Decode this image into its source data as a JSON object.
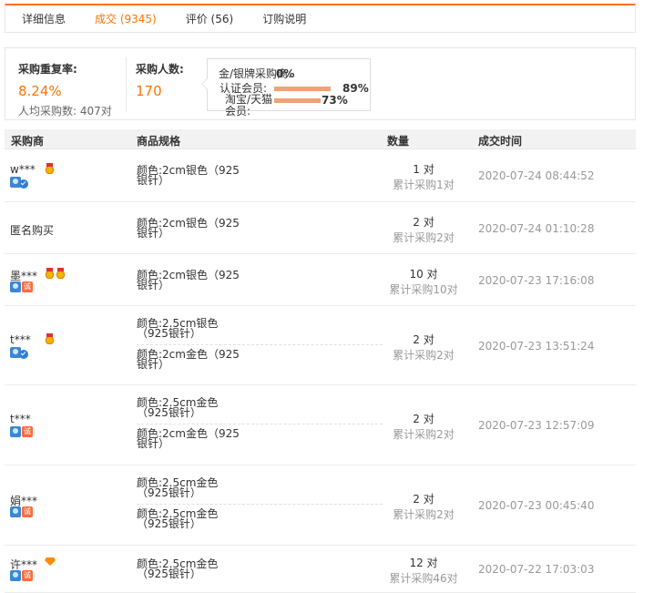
{
  "tabs": [
    {
      "label": "详细信息"
    },
    {
      "label": "成交 (9345)"
    },
    {
      "label": "评价 (56)"
    },
    {
      "label": "订购说明"
    }
  ],
  "summary": {
    "repeat_label": "采购重复率:",
    "repeat_value": "8.24%",
    "avg_label": "人均采购数:",
    "avg_value": "407对",
    "buyers_label": "采购人数:",
    "buyers_value": "170",
    "popup": {
      "rows": [
        {
          "label": "金/银牌采购商:",
          "pct": "0%",
          "fraction": 0.0
        },
        {
          "label": "认证会员:",
          "pct": "89%",
          "fraction": 0.89
        },
        {
          "label": "淘宝/天猫会员:",
          "pct": "73%",
          "fraction": 0.73
        }
      ]
    }
  },
  "table": {
    "headers": [
      "采购商",
      "商品规格",
      "数量",
      "成交时间"
    ],
    "rows": [
      {
        "buyer": "w***",
        "badges": [
          "medal",
          "user",
          "check"
        ],
        "specs": [
          "颜色:2cm银色（925银针）"
        ],
        "qty": "1 对",
        "acc": "累计采购1对",
        "time": "2020-07-24 08:44:52"
      },
      {
        "buyer": "匿名购买",
        "badges": [],
        "specs": [
          "颜色:2cm银色（925银针）"
        ],
        "qty": "2 对",
        "acc": "累计采购2对",
        "time": "2020-07-24 01:10:28"
      },
      {
        "buyer": "墨***",
        "badges": [
          "medal",
          "medal",
          "user",
          "cheng"
        ],
        "specs": [
          "颜色:2cm银色（925银针）"
        ],
        "qty": "10 对",
        "acc": "累计采购10对",
        "time": "2020-07-23 17:16:08"
      },
      {
        "buyer": "t***",
        "badges": [
          "medal",
          "user",
          "check"
        ],
        "specs": [
          "颜色:2.5cm银色（925银针）",
          "颜色:2cm金色（925银针）"
        ],
        "qty": "2 对",
        "acc": "累计采购2对",
        "time": "2020-07-23 13:51:24"
      },
      {
        "buyer": "t***",
        "badges": [
          "user",
          "cheng"
        ],
        "specs": [
          "颜色:2.5cm金色（925银针）",
          "颜色:2cm金色（925银针）"
        ],
        "qty": "2 对",
        "acc": "累计采购2对",
        "time": "2020-07-23 12:57:09"
      },
      {
        "buyer": "娟***",
        "badges": [
          "user",
          "cheng"
        ],
        "specs": [
          "颜色:2.5cm金色（925银针）",
          "颜色:2.5cm金色（925银针）"
        ],
        "qty": "2 对",
        "acc": "累计采购2对",
        "time": "2020-07-23 00:45:40"
      },
      {
        "buyer": "许***",
        "badges": [
          "diamond",
          "user",
          "cheng"
        ],
        "specs": [
          "颜色:2.5cm金色（925银针）"
        ],
        "qty": "12 对",
        "acc": "累计采购46对",
        "time": "2020-07-22 17:03:03"
      }
    ]
  },
  "colors": {
    "accent": "#ff7300",
    "bar": "#f0a273"
  }
}
